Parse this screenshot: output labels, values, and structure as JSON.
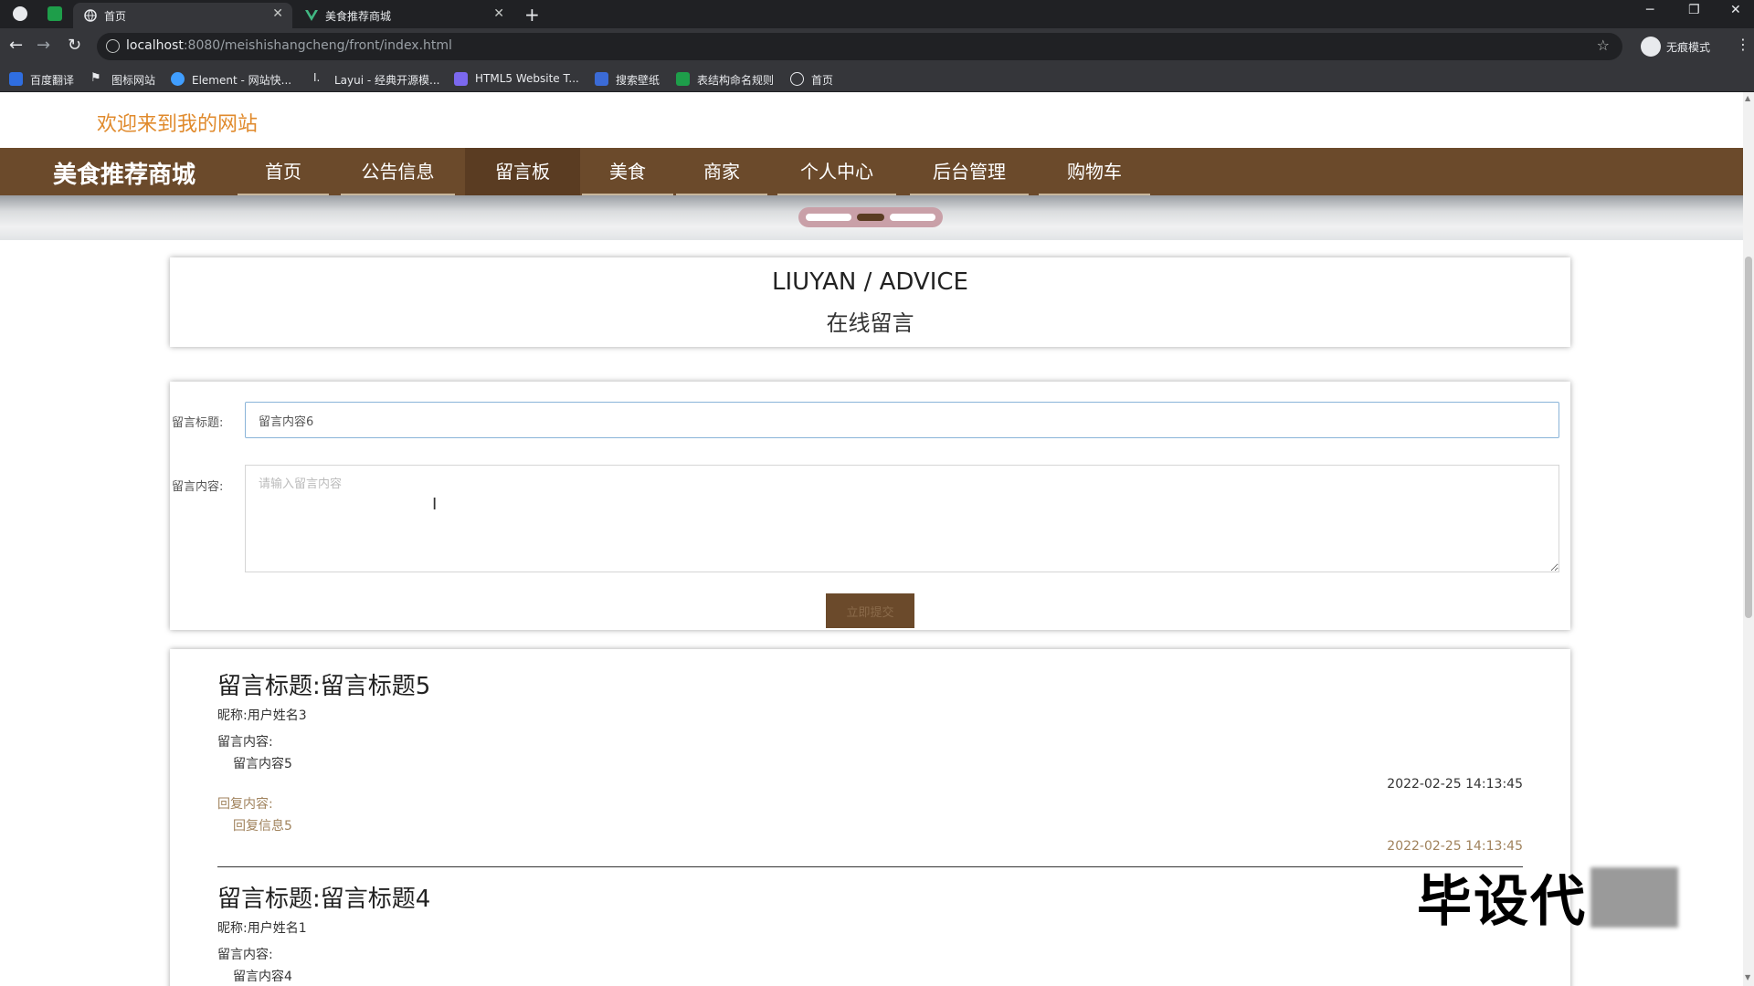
{
  "browser": {
    "tabs": [
      {
        "label": "首页",
        "active": true
      },
      {
        "label": "美食推荐商城",
        "active": false
      }
    ],
    "new_tab": "+",
    "window_controls": {
      "minimize": "─",
      "restore": "❐",
      "close": "✕"
    },
    "nav": {
      "back": "←",
      "forward": "→",
      "reload": "↻"
    },
    "url_host": "localhost",
    "url_path": ":8080/meishishangcheng/front/index.html",
    "star": "☆",
    "profile_label": "无痕模式",
    "menu": "⋮",
    "bookmarks": [
      {
        "label": "百度翻译",
        "icon": "translate-icon",
        "color": "#2f6ee0"
      },
      {
        "label": "图标网站",
        "icon": "flag-icon",
        "color": "#e8eaed"
      },
      {
        "label": "Element - 网站快...",
        "icon": "element-icon",
        "color": "#409eff"
      },
      {
        "label": "Layui - 经典开源模...",
        "icon": "layui-icon",
        "color": "#e8eaed"
      },
      {
        "label": "HTML5 Website T...",
        "icon": "html5-icon",
        "color": "#7b68ee"
      },
      {
        "label": "搜索壁纸",
        "icon": "wallpaper-icon",
        "color": "#3b6bd6"
      },
      {
        "label": "表结构命名规则",
        "icon": "sheet-icon",
        "color": "#1e9e4a"
      },
      {
        "label": "首页",
        "icon": "globe-icon",
        "color": "#e8eaed"
      }
    ]
  },
  "site": {
    "welcome": "欢迎来到我的网站",
    "brand": "美食推荐商城",
    "nav_items": [
      {
        "label": "首页",
        "active": false
      },
      {
        "label": "公告信息",
        "active": false
      },
      {
        "label": "留言板",
        "active": true
      },
      {
        "label": "美食",
        "active": false
      },
      {
        "label": "商家",
        "active": false
      },
      {
        "label": "个人中心",
        "active": false
      },
      {
        "label": "后台管理",
        "active": false
      },
      {
        "label": "购物车",
        "active": false
      }
    ],
    "carousel_active_index": 1
  },
  "header_card": {
    "title_en": "LIUYAN / ADVICE",
    "title_cn": "在线留言"
  },
  "form": {
    "title_label": "留言标题:",
    "title_value": "留言内容6",
    "content_label": "留言内容:",
    "content_placeholder": "请输入留言内容",
    "submit_label": "立即提交"
  },
  "messages": [
    {
      "title": "留言标题:留言标题5",
      "nickname": "昵称:用户姓名3",
      "content_label": "留言内容:",
      "content": "留言内容5",
      "time": "2022-02-25 14:13:45",
      "reply_label": "回复内容:",
      "reply": "回复信息5",
      "reply_time": "2022-02-25 14:13:45"
    },
    {
      "title": "留言标题:留言标题4",
      "nickname": "昵称:用户姓名1",
      "content_label": "留言内容:",
      "content": "留言内容4"
    }
  ],
  "watermark": "毕设代"
}
